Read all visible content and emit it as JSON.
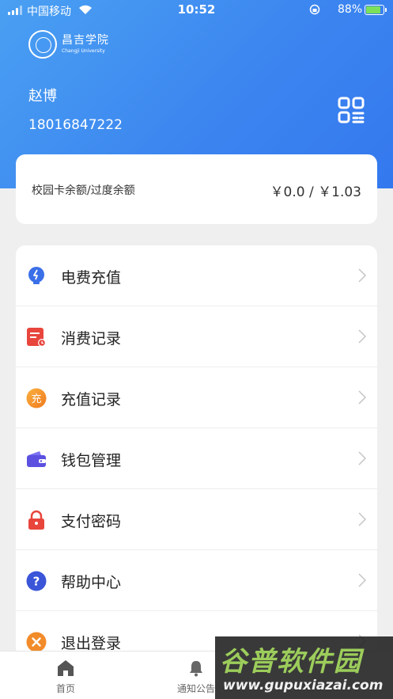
{
  "status_bar": {
    "carrier": "中国移动",
    "time": "10:52",
    "battery": "88%",
    "battery_level": 0.88
  },
  "header": {
    "logo_text_cn": "昌吉学院",
    "logo_text_en": "Changji University",
    "user_name": "赵博",
    "phone": "18016847222",
    "qr_icon": "qr-code-icon"
  },
  "balance": {
    "label": "校园卡余额/过度余额",
    "value": "￥0.0 /  ￥1.03"
  },
  "menu": {
    "items": [
      {
        "label": "电费充值",
        "icon": "lightbulb-icon",
        "color": "#3a6fe8"
      },
      {
        "label": "消费记录",
        "icon": "receipt-icon",
        "color": "#e8453c"
      },
      {
        "label": "充值记录",
        "icon": "recharge-icon",
        "color": "#f28b2a"
      },
      {
        "label": "钱包管理",
        "icon": "wallet-icon",
        "color": "#5b50e0"
      },
      {
        "label": "支付密码",
        "icon": "lock-icon",
        "color": "#e8453c"
      },
      {
        "label": "帮助中心",
        "icon": "help-icon",
        "color": "#3a55d8"
      },
      {
        "label": "退出登录",
        "icon": "logout-icon",
        "color": "#f28b2a"
      }
    ],
    "recharge_glyph": "充",
    "help_glyph": "?"
  },
  "tab_bar": {
    "tabs": [
      {
        "label": "首页",
        "icon": "home-icon"
      },
      {
        "label": "通知公告",
        "icon": "bell-icon"
      }
    ]
  },
  "watermark": {
    "title": "谷普软件园",
    "url": "www.gupuxiazai.com"
  },
  "colors": {
    "header_start": "#4aa0f2",
    "header_end": "#3478ee",
    "background": "#efefef"
  }
}
